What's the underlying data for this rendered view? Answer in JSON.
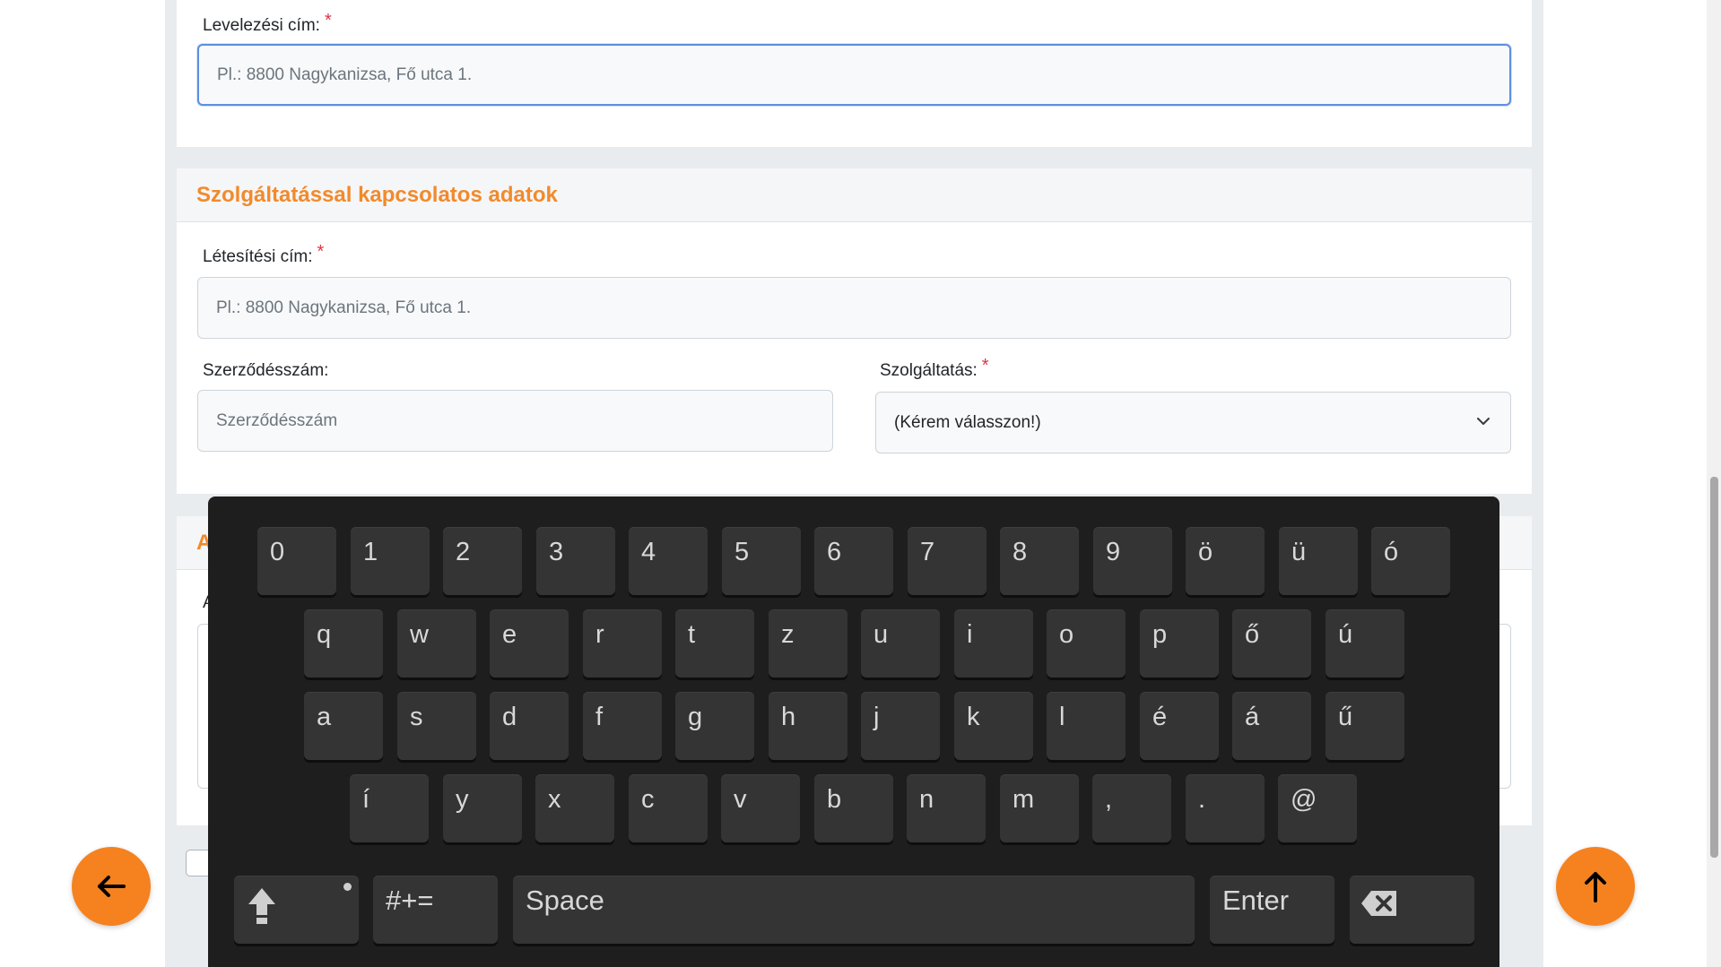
{
  "section1": {
    "mailing_address_label": "Levelezési cím:",
    "mailing_address_placeholder": "Pl.: 8800 Nagykanizsa, Fő utca 1.",
    "required_mark": "*"
  },
  "section2": {
    "title": "Szolgáltatással kapcsolatos adatok",
    "install_address_label": "Létesítési cím:",
    "install_address_placeholder": "Pl.: 8800 Nagykanizsa, Fő utca 1.",
    "contract_label": "Szerződésszám:",
    "contract_placeholder": "Szerződésszám",
    "service_label": "Szolgáltatás:",
    "service_selected": "(Kérem válasszon!)",
    "required_mark": "*"
  },
  "section3": {
    "title_visible": "A",
    "field_label_visible": "A"
  },
  "keyboard": {
    "rows": [
      [
        "0",
        "1",
        "2",
        "3",
        "4",
        "5",
        "6",
        "7",
        "8",
        "9",
        "ö",
        "ü",
        "ó"
      ],
      [
        "q",
        "w",
        "e",
        "r",
        "t",
        "z",
        "u",
        "i",
        "o",
        "p",
        "ő",
        "ú"
      ],
      [
        "a",
        "s",
        "d",
        "f",
        "g",
        "h",
        "j",
        "k",
        "l",
        "é",
        "á",
        "ű"
      ],
      [
        "í",
        "y",
        "x",
        "c",
        "v",
        "b",
        "n",
        "m",
        ",",
        ".",
        "@"
      ]
    ],
    "symbols_label": "#+=",
    "space_label": "Space",
    "enter_label": "Enter",
    "shift_icon": "shift-icon",
    "backspace_icon": "backspace-icon"
  },
  "fab": {
    "back_icon": "arrow-left-icon",
    "top_icon": "arrow-up-icon",
    "color": "#f5821f"
  },
  "colors": {
    "accent": "#f28a2b",
    "required": "#dc3545",
    "keyboard_bg": "#1e1e1e",
    "key_bg": "#343434"
  }
}
